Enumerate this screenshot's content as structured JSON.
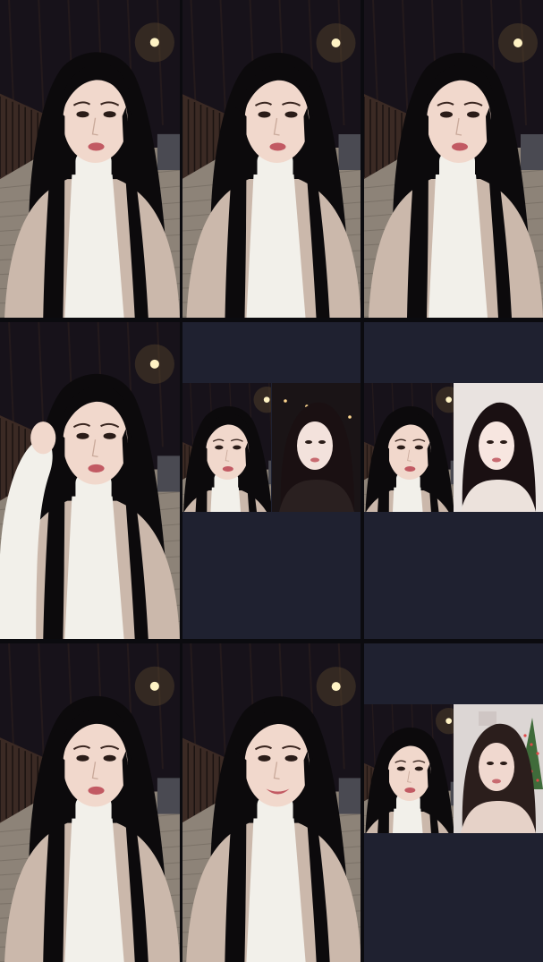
{
  "grid": {
    "rows": 3,
    "cols": 3,
    "background_color": "#0b0b0f",
    "empty_panel_color": "#1f2130"
  },
  "tiles": [
    {
      "kind": "single",
      "scene": "street-night-selfie"
    },
    {
      "kind": "single",
      "scene": "street-night-selfie"
    },
    {
      "kind": "single",
      "scene": "street-night-selfie"
    },
    {
      "kind": "single",
      "scene": "street-night-selfie-hand"
    },
    {
      "kind": "split",
      "scenes": [
        "street-night-selfie",
        "street-night-guest"
      ]
    },
    {
      "kind": "split",
      "scenes": [
        "street-night-selfie",
        "indoor-light-guest"
      ]
    },
    {
      "kind": "single",
      "scene": "street-night-selfie"
    },
    {
      "kind": "single",
      "scene": "street-night-selfie-smile"
    },
    {
      "kind": "split",
      "scenes": [
        "street-night-selfie",
        "indoor-christmas-guest"
      ]
    }
  ],
  "colors": {
    "sky": "#17121a",
    "streetlight": "#fff3c4",
    "hair": "#0c0a0c",
    "skin": "#f1d8cc",
    "jacket": "#f2f0ea",
    "coat": "#cbb8ab",
    "lips": "#c25a63",
    "pavement": "#8d8378",
    "fence": "#3b2a24"
  }
}
